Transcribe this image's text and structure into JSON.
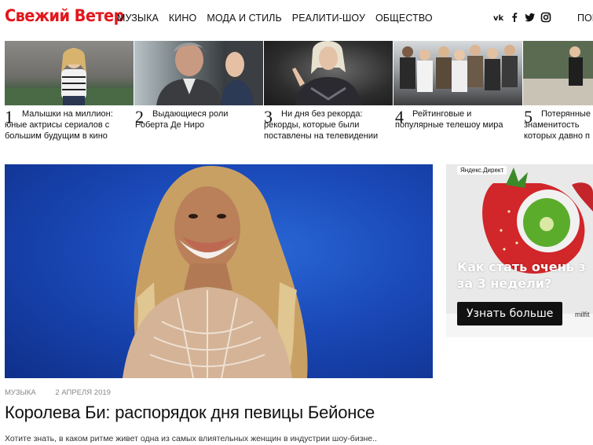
{
  "header": {
    "logo": "Свежий Ветер",
    "nav": [
      "МУЗЫКА",
      "КИНО",
      "МОДА И СТИЛЬ",
      "РЕАЛИТИ-ШОУ",
      "ОБЩЕСТВО"
    ],
    "nav_cut": "ПОГ",
    "social_icons": [
      "vk-icon",
      "facebook-icon",
      "twitter-icon",
      "instagram-icon"
    ],
    "brand_color": "#e2161c"
  },
  "top_list": [
    {
      "number": "1",
      "title": "Малышки на миллион: юные актрисы сериалов с большим будущим в кино"
    },
    {
      "number": "2",
      "title": "Выдающиеся роли Роберта Де Ниро"
    },
    {
      "number": "3",
      "title": "Ни дня без рекорда: рекорды, которые были поставлены на телевидении"
    },
    {
      "number": "4",
      "title": "Рейтинговые и популярные телешоу мира"
    },
    {
      "number": "5",
      "title": "Потерянные з знаменитость которых давно п"
    }
  ],
  "article": {
    "category": "МУЗЫКА",
    "date": "2 АПРЕЛЯ 2019",
    "title": "Королева Би: распорядок дня певицы Бейонсе",
    "lead": "Хотите знать, в каком ритме живет одна из самых влиятельных женщин в индустрии шоу-бизне.."
  },
  "ad": {
    "badge": "Яндекс.Директ",
    "headline_line1": "Как стать очень з",
    "headline_line2": "за 3 недели?",
    "button": "Узнать больше",
    "domain": "milfit"
  }
}
